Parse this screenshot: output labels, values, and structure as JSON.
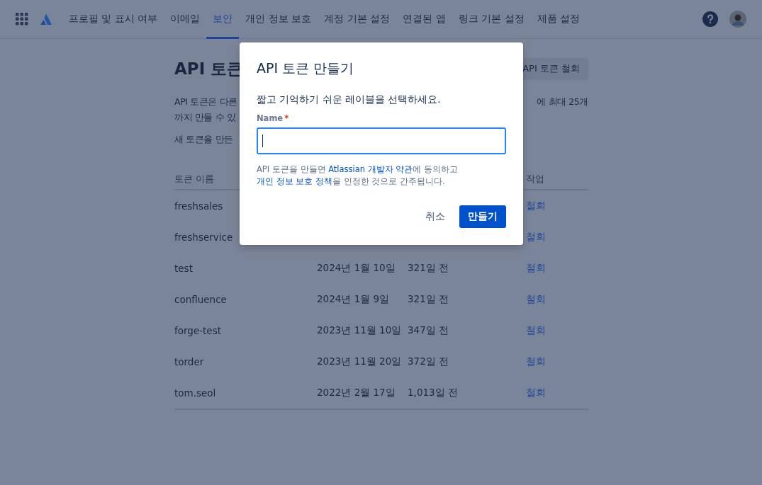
{
  "nav": {
    "tabs": [
      {
        "label": "프로필 및 표시 여부",
        "selected": false
      },
      {
        "label": "이메일",
        "selected": false
      },
      {
        "label": "보안",
        "selected": true
      },
      {
        "label": "개인 정보 보호",
        "selected": false
      },
      {
        "label": "계정 기본 설정",
        "selected": false
      },
      {
        "label": "연결된 앱",
        "selected": false
      },
      {
        "label": "링크 기본 설정",
        "selected": false
      },
      {
        "label": "제품 설정",
        "selected": false
      }
    ]
  },
  "page": {
    "title": "API 토큰",
    "revoke_all_button": "API 토큰 철회",
    "intro_left": [
      "API 토큰은 다른",
      "까지 만들 수 있"
    ],
    "intro_right": "에 최대 25개",
    "new_token_text": "새 토큰을 만든"
  },
  "table": {
    "header": {
      "name": "토큰 이름",
      "action": "작업"
    },
    "rows": [
      {
        "name": "freshsales",
        "action": "철회"
      },
      {
        "name": "freshservice",
        "action": "철회"
      },
      {
        "name": "test",
        "column_2": "2024년 1월 10일",
        "column_3": "321일 전",
        "action": "철회"
      },
      {
        "name": "confluence",
        "column_2": "2024년 1월 9일",
        "column_3": "321일 전",
        "action": "철회"
      },
      {
        "name": "forge-test",
        "column_2": "2023년 11월 10일",
        "column_3": "347일 전",
        "action": "철회"
      },
      {
        "name": "torder",
        "column_2": "2023년 11월 20일",
        "column_3": "372일 전",
        "action": "철회"
      },
      {
        "name": "tom.seol",
        "column_2": "2022년 2월 17일",
        "column_3": "1,013일 전",
        "action": "철회"
      }
    ]
  },
  "modal": {
    "title": "API 토큰 만들기",
    "description": "짧고 기억하기 쉬운 레이블을 선택하세요.",
    "field_label": "Name",
    "required_mark": "*",
    "focused": true,
    "terms": [
      {
        "text": "API 토큰을 만들면 ",
        "link": false
      },
      {
        "text": "Atlassian 개발자 약관",
        "link": true
      },
      {
        "text": "에 동의하고 ",
        "link": false
      },
      {
        "text": "개인 정보 보호 정책",
        "link": true
      },
      {
        "text": "을 인정한 것으로 간주됩니다.",
        "link": false
      }
    ],
    "cancel_button": "취소",
    "create_button": "만들기"
  }
}
